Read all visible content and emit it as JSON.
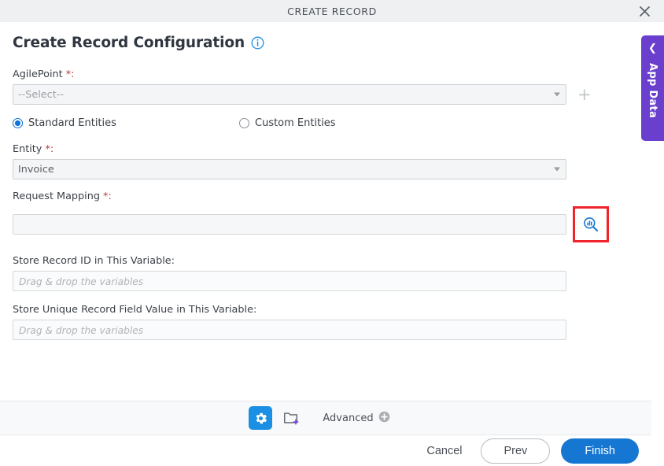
{
  "window": {
    "title": "CREATE RECORD",
    "close_icon": "close-icon"
  },
  "page": {
    "title": "Create Record Configuration",
    "info_icon": "info-icon"
  },
  "form": {
    "agilepoint": {
      "label": "AgilePoint",
      "required_mark": "*:",
      "value": "--Select--",
      "add_icon": "plus-icon"
    },
    "entity_type": {
      "options": [
        {
          "label": "Standard Entities",
          "checked": true
        },
        {
          "label": "Custom Entities",
          "checked": false
        }
      ]
    },
    "entity": {
      "label": "Entity",
      "required_mark": "*:",
      "value": "Invoice"
    },
    "request_mapping": {
      "label": "Request Mapping",
      "required_mark": "*:",
      "value": "",
      "lookup_icon": "schema-search-icon"
    },
    "store_record_id": {
      "label": "Store Record ID in This Variable:",
      "value": "",
      "placeholder": "Drag & drop the variables"
    },
    "store_unique_field": {
      "label": "Store Unique Record Field Value in This Variable:",
      "value": "",
      "placeholder": "Drag & drop the variables"
    }
  },
  "toolbar": {
    "gear_icon": "gear-icon",
    "folder_icon": "new-folder-icon",
    "advanced_label": "Advanced",
    "advanced_icon": "circle-plus-icon"
  },
  "footer": {
    "cancel_label": "Cancel",
    "prev_label": "Prev",
    "finish_label": "Finish"
  },
  "side_tab": {
    "label": "App Data",
    "chevron_icon": "chevron-left-icon"
  },
  "colors": {
    "accent_blue": "#1677d2",
    "highlight_red": "#f0242b",
    "purple": "#6b3fce",
    "titlebar_bg": "#eff0f2",
    "required_red": "#b33a3a"
  }
}
